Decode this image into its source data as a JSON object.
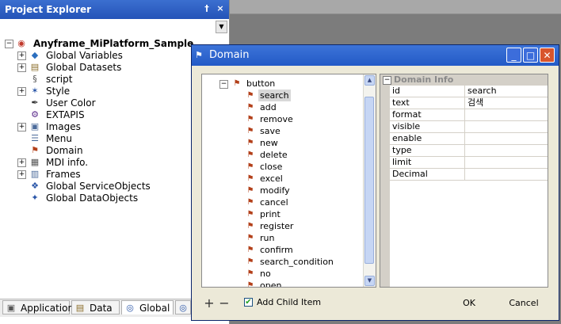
{
  "explorer": {
    "title": "Project Explorer",
    "pin_glyph": "†",
    "close_glyph": "×",
    "tree": [
      {
        "label": "Anyframe_MiPlatform_Sample",
        "icon": "project-icon",
        "expander": "−",
        "bold": true
      },
      {
        "label": "Global Variables",
        "icon": "variables-icon",
        "expander": "+"
      },
      {
        "label": "Global Datasets",
        "icon": "datasets-icon",
        "expander": "+"
      },
      {
        "label": "script",
        "icon": "script-icon",
        "expander": ""
      },
      {
        "label": "Style",
        "icon": "style-icon",
        "expander": "+"
      },
      {
        "label": "User Color",
        "icon": "user-color-icon",
        "expander": ""
      },
      {
        "label": "EXTAPIS",
        "icon": "extapis-icon",
        "expander": ""
      },
      {
        "label": "Images",
        "icon": "images-icon",
        "expander": "+"
      },
      {
        "label": "Menu",
        "icon": "menu-icon",
        "expander": ""
      },
      {
        "label": "Domain",
        "icon": "domain-icon",
        "expander": ""
      },
      {
        "label": "MDI info.",
        "icon": "mdi-icon",
        "expander": "+"
      },
      {
        "label": "Frames",
        "icon": "frames-icon",
        "expander": "+"
      },
      {
        "label": "Global ServiceObjects",
        "icon": "service-objects-icon",
        "expander": ""
      },
      {
        "label": "Global DataObjects",
        "icon": "data-objects-icon",
        "expander": ""
      }
    ],
    "tabs": [
      {
        "label": "Applications",
        "icon": "applications-icon"
      },
      {
        "label": "Data",
        "icon": "data-icon"
      },
      {
        "label": "Global",
        "icon": "global-icon"
      }
    ]
  },
  "dialog": {
    "title": "Domain",
    "domain_list": {
      "root": {
        "label": "button",
        "expander": "−"
      },
      "items": [
        "search",
        "add",
        "remove",
        "save",
        "new",
        "delete",
        "close",
        "excel",
        "modify",
        "cancel",
        "print",
        "register",
        "run",
        "confirm",
        "search_condition",
        "no",
        "open"
      ],
      "selected": "search"
    },
    "domain_info": {
      "header": "Domain Info",
      "rows": [
        {
          "name": "id",
          "value": "search"
        },
        {
          "name": "text",
          "value": "검색"
        },
        {
          "name": "format",
          "value": ""
        },
        {
          "name": "visible",
          "value": ""
        },
        {
          "name": "enable",
          "value": ""
        },
        {
          "name": "type",
          "value": ""
        },
        {
          "name": "limit",
          "value": ""
        },
        {
          "name": "Decimal",
          "value": ""
        }
      ]
    },
    "footer": {
      "add_glyph": "+",
      "remove_glyph": "−",
      "add_child_label": "Add Child Item",
      "add_child_checked": true,
      "ok_label": "OK",
      "cancel_label": "Cancel"
    }
  },
  "colors": {
    "title_bar": "#2453b8",
    "dialog_bg": "#ece9d8",
    "domain_icon": "#b3401a"
  }
}
